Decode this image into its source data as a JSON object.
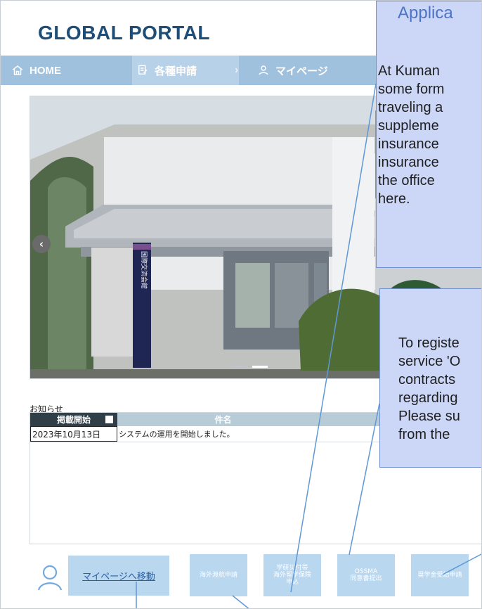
{
  "app": {
    "title": "GLOBAL PORTAL"
  },
  "nav": {
    "home_label": "HOME",
    "forms_label": "各種申請",
    "separator": "›",
    "mypage_label": "マイページ"
  },
  "carousel": {
    "prev_icon": "chevron-left-icon",
    "slide_text": "国際交流会館"
  },
  "news": {
    "title": "お知らせ",
    "columns": [
      "掲載開始",
      "件名"
    ],
    "rows": [
      [
        "2023年10月13日",
        "システムの運用を開始しました。"
      ]
    ]
  },
  "footer": {
    "mypage_link": "マイページへ移動",
    "buttons": [
      {
        "label": "海外渡航申請"
      },
      {
        "label_lines": [
          "学研災付帯",
          "海外留学保険",
          "申込"
        ]
      },
      {
        "label_lines": [
          "OSSMA",
          "同意書提出"
        ]
      },
      {
        "label": "奨学金受給申請"
      }
    ]
  },
  "popups": {
    "popup1_title": "Applica",
    "popup1_lines": [
      "At Kuman",
      "some form",
      "traveling a",
      "suppleme",
      "insurance",
      "insurance",
      "the office",
      "here."
    ],
    "popup2_lines": [
      "To registe",
      "service 'O",
      "contracts",
      "regarding",
      "Please su",
      "from the"
    ]
  },
  "colors": {
    "brand": "#1e4e78",
    "nav": "#9fc1dd",
    "nav_active": "#b7d1e8",
    "button": "#b9d7ef",
    "popup": "#ccd7f8",
    "popup_border": "#6f8fd1"
  }
}
